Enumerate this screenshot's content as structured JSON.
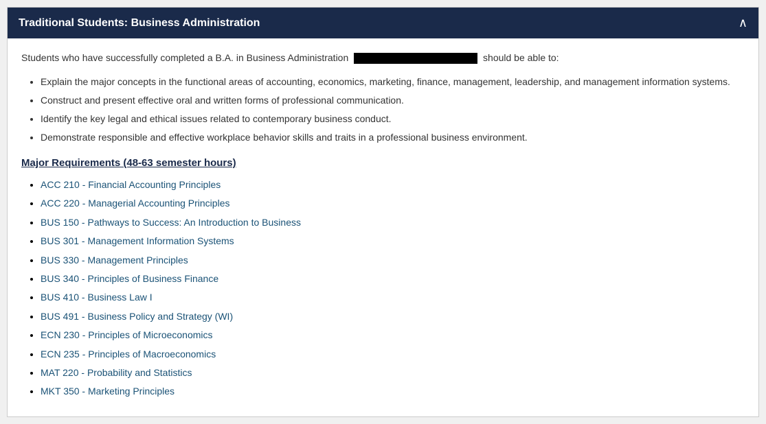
{
  "header": {
    "title": "Traditional Students: Business Administration",
    "chevron": "∧"
  },
  "intro": {
    "text_before": "Students who have successfully completed a B.A. in Business Administration",
    "text_after": "should be able to:"
  },
  "outcomes": [
    "Explain the major concepts in the functional areas of accounting, economics, marketing, finance, management, leadership, and management information systems.",
    "Construct and present effective oral and written forms of professional communication.",
    "Identify the key legal and ethical issues related to contemporary business conduct.",
    "Demonstrate responsible and effective workplace behavior skills and traits in a professional business environment."
  ],
  "major_requirements": {
    "heading": "Major Requirements (48-63 semester hours)",
    "courses": [
      {
        "code": "ACC 210",
        "title": "Financial Accounting Principles"
      },
      {
        "code": "ACC 220",
        "title": "Managerial Accounting Principles"
      },
      {
        "code": "BUS 150",
        "title": "Pathways to Success: An Introduction to Business"
      },
      {
        "code": "BUS 301",
        "title": "Management Information Systems"
      },
      {
        "code": "BUS 330",
        "title": "Management Principles"
      },
      {
        "code": "BUS 340",
        "title": "Principles of Business Finance"
      },
      {
        "code": "BUS 410",
        "title": "Business Law I"
      },
      {
        "code": "BUS 491",
        "title": "Business Policy and Strategy (WI)"
      },
      {
        "code": "ECN 230",
        "title": "Principles of Microeconomics"
      },
      {
        "code": "ECN 235",
        "title": "Principles of Macroeconomics"
      },
      {
        "code": "MAT 220",
        "title": "Probability and Statistics"
      },
      {
        "code": "MKT 350",
        "title": "Marketing Principles"
      }
    ]
  }
}
